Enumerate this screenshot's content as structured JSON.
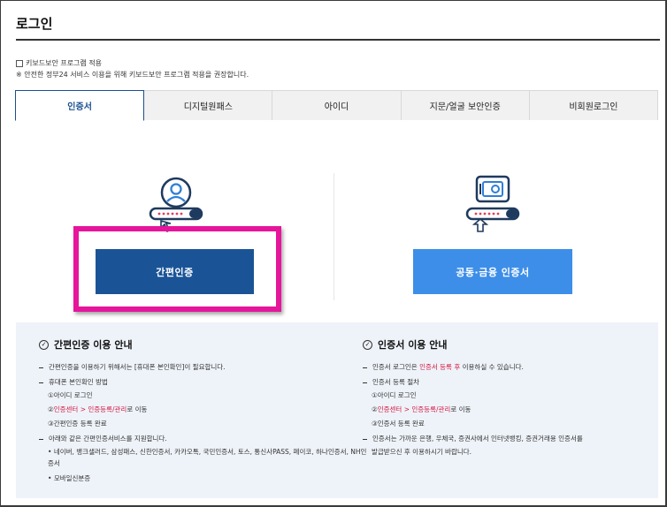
{
  "page": {
    "title": "로그인"
  },
  "keyboard_security": {
    "checkbox_label": "키보드보안 프로그램 적용",
    "note": "※ 안전한 정부24 서비스 이용을 위해 키보드보안 프로그램 적용을 권장합니다."
  },
  "tabs": [
    {
      "label": "인증서",
      "active": true
    },
    {
      "label": "디지털원패스",
      "active": false
    },
    {
      "label": "아이디",
      "active": false
    },
    {
      "label": "지문/얼굴 보안인증",
      "active": false
    },
    {
      "label": "비회원로그인",
      "active": false
    }
  ],
  "login_options": {
    "simple_auth_button": "간편인증",
    "cert_button": "공동·금융 인증서",
    "icons": [
      "person-card-icon",
      "safe-card-icon"
    ]
  },
  "guide_simple": {
    "title": "간편인증 이용 안내",
    "line1": "간편인증을 이용하기 위해서는 [휴대폰 본인확인]이 필요합니다.",
    "line2": "휴대폰 본인확인 방법",
    "step1": "①아이디 로그인",
    "step2_prefix": "②",
    "step2_link": "인증센터 > 인증등록/관리",
    "step2_suffix": "로 이동",
    "step3": "③간편인증 등록 완료",
    "line3": "아래와 같은 간편인증서비스를 지원합니다.",
    "providers_a": "네이버, 뱅크샐러드, 삼성패스, 신한인증서, 카카오톡, 국민인증서, 토스, 통신사PASS, 페이코, 하나인증서, NH인",
    "providers_b": "증서",
    "mobile_id": "모바일신분증"
  },
  "guide_cert": {
    "title": "인증서 이용 안내",
    "line1_prefix": "인증서 로그인은 ",
    "line1_link": "인증서 등록 후",
    "line1_suffix": " 이용하실 수 있습니다.",
    "line2": "인증서 등록 절차",
    "step1": "①아이디 로그인",
    "step2_prefix": "②",
    "step2_link": "인증센터 > 인증등록/관리",
    "step2_suffix": "로 이동",
    "step3": "③인증서 등록 완료",
    "line3a": "인증서는 가까운 은행, 우체국, 증권사에서 인터넷뱅킹, 증권거래용 인증서를",
    "line3b": "발급받으신 후 이용하시기 바랍니다."
  },
  "colors": {
    "accent_navy": "#1a5497",
    "accent_blue": "#3d8ee8",
    "highlight_pink": "#e6159b",
    "link_red": "#d4143d",
    "guide_bg": "#eef3f9"
  }
}
